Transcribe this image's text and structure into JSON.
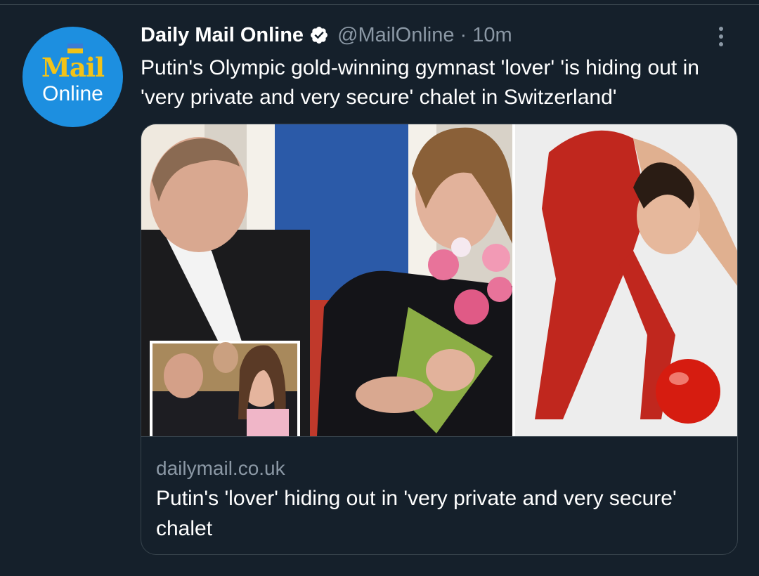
{
  "tweet": {
    "author_name": "Daily Mail Online",
    "handle": "@MailOnline",
    "separator": "·",
    "time": "10m",
    "text": "Putin's Olympic gold-winning gymnast 'lover' 'is hiding out in 'very private and very secure' chalet in Switzerland'",
    "verified_icon": "verified-badge-icon",
    "more_icon": "more-options-icon"
  },
  "avatar": {
    "logo": "Mail",
    "subtitle": "Online",
    "bg_color": "#1d8fe0",
    "logo_color": "#f2c318"
  },
  "card": {
    "domain": "dailymail.co.uk",
    "title": "Putin's 'lover' hiding out in 'very private and very secure' chalet"
  },
  "colors": {
    "background": "#15202b",
    "secondary_text": "#8b98a5",
    "border": "#38444d",
    "verified": "#ffffff"
  }
}
